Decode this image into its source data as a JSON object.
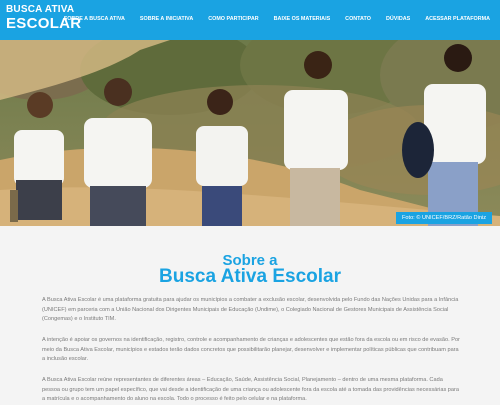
{
  "header": {
    "logo_line1": "BUSCA ATIVA",
    "logo_line2": "ESCOLAR",
    "nav": [
      "SOBRE A BUSCA ATIVA",
      "SOBRE A INICIATIVA",
      "COMO PARTICIPAR",
      "BAIXE OS MATERIAIS",
      "CONTATO",
      "DÚVIDAS",
      "ACESSAR PLATAFORMA"
    ]
  },
  "hero": {
    "credit": "Foto: © UNICEF/BRZ/Ratão Diniz"
  },
  "content": {
    "title_small": "Sobre a",
    "title_large": "Busca Ativa Escolar",
    "paragraphs": [
      "A Busca Ativa Escolar é uma plataforma gratuita para ajudar os municípios a combater a exclusão escolar, desenvolvida pelo Fundo das Nações Unidas para a Infância (UNICEF) em parceria com a União Nacional dos Dirigentes Municipais de Educação (Undime), o Colegiado Nacional de Gestores Municipais de Assistência Social (Congemas) e o Instituto TIM.",
      "A intenção é apoiar os governos na identificação, registro, controle e acompanhamento de crianças e adolescentes que estão fora da escola ou em risco de evasão. Por meio da Busca Ativa Escolar, municípios e estados terão dados concretos que possibilitarão planejar, desenvolver e implementar políticas públicas que contribuam para a inclusão escolar.",
      "A Busca Ativa Escolar reúne representantes de diferentes áreas – Educação, Saúde, Assistência Social, Planejamento – dentro de uma mesma plataforma. Cada pessoa ou grupo tem um papel específico, que vai desde a identificação de uma criança ou adolescente fora da escola até a tomada das providências necessárias para a matrícula e o acompanhamento do aluno na escola. Todo o processo é feito pelo celular e na plataforma."
    ]
  },
  "colors": {
    "brand_blue": "#1aa3e2",
    "text_gray": "#7a7a7a",
    "background": "#f4f4f4"
  }
}
